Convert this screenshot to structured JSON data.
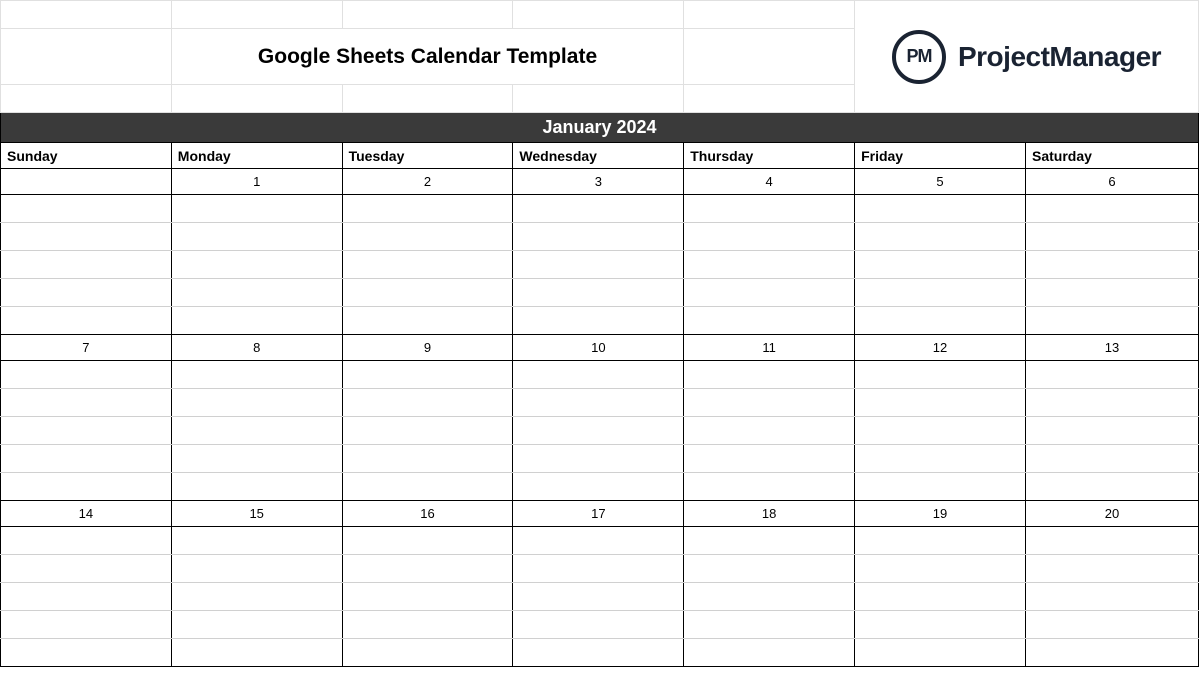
{
  "header": {
    "title": "Google Sheets Calendar Template",
    "logo_initials": "PM",
    "logo_text": "ProjectManager"
  },
  "calendar": {
    "month_label": "January 2024",
    "day_names": [
      "Sunday",
      "Monday",
      "Tuesday",
      "Wednesday",
      "Thursday",
      "Friday",
      "Saturday"
    ],
    "weeks": [
      [
        "",
        "1",
        "2",
        "3",
        "4",
        "5",
        "6"
      ],
      [
        "7",
        "8",
        "9",
        "10",
        "11",
        "12",
        "13"
      ],
      [
        "14",
        "15",
        "16",
        "17",
        "18",
        "19",
        "20"
      ]
    ]
  }
}
